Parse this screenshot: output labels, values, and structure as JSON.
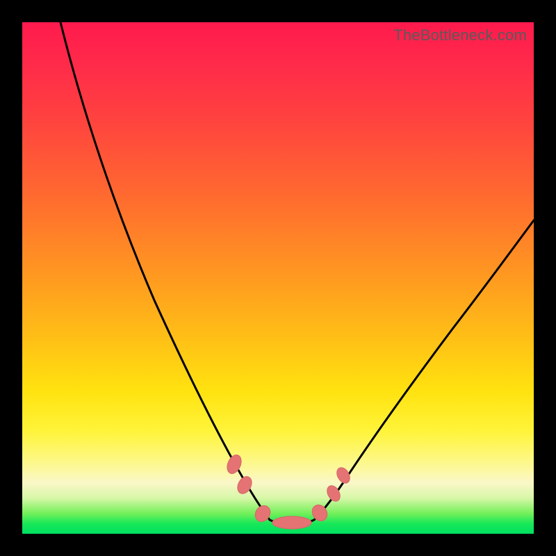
{
  "watermark": "TheBottleneck.com",
  "colors": {
    "frame": "#000000",
    "gradient_top": "#ff1a4d",
    "gradient_mid_orange": "#ff9a20",
    "gradient_yellow": "#ffe20f",
    "gradient_pale": "#faf7c8",
    "gradient_green": "#00e060",
    "curve": "#000000",
    "marker": "#e57373"
  },
  "chart_data": {
    "type": "line",
    "title": "",
    "xlabel": "",
    "ylabel": "",
    "xlim": [
      0,
      100
    ],
    "ylim": [
      0,
      100
    ],
    "grid": false,
    "legend": false,
    "note": "Axes are unitless percentages of the plot area; y=100 is top, y=0 is bottom. Curve is a V-shape with a flat floor near x≈45–55.",
    "series": [
      {
        "name": "curve",
        "x": [
          0,
          5,
          10,
          15,
          20,
          25,
          30,
          35,
          40,
          45,
          50,
          55,
          60,
          65,
          70,
          75,
          80,
          85,
          90,
          95,
          100
        ],
        "y": [
          100,
          90,
          80,
          69,
          58,
          46,
          35,
          24,
          14,
          4,
          2,
          4,
          11,
          19,
          27,
          35,
          42,
          49,
          55,
          60,
          65
        ]
      }
    ],
    "markers": {
      "name": "floor-blobs",
      "color": "#e57373",
      "points": [
        {
          "x": 39,
          "y": 13
        },
        {
          "x": 41,
          "y": 9
        },
        {
          "x": 45,
          "y": 3
        },
        {
          "x": 50,
          "y": 2
        },
        {
          "x": 55,
          "y": 3
        },
        {
          "x": 58,
          "y": 8
        },
        {
          "x": 60,
          "y": 12
        }
      ]
    }
  }
}
